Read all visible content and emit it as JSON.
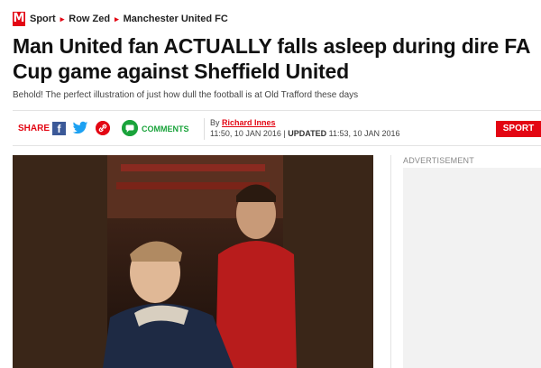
{
  "breadcrumb": {
    "logo": "M",
    "items": [
      "Sport",
      "Row Zed",
      "Manchester United FC"
    ]
  },
  "article": {
    "headline": "Man United fan ACTUALLY falls asleep during dire FA Cup game against Sheffield United",
    "standfirst": "Behold! The perfect illustration of just how dull the football is at Old Trafford these days"
  },
  "share": {
    "label": "SHARE",
    "facebook": "f",
    "comments_label": "COMMENTS"
  },
  "byline": {
    "by": "By",
    "author": "Richard Innes",
    "published": "11:50, 10 JAN 2016",
    "separator": "|",
    "updated_label": "UPDATED",
    "updated": "11:53, 10 JAN 2016"
  },
  "section_button": "SPORT",
  "advert": {
    "label": "ADVERTISEMENT"
  },
  "colors": {
    "brand": "#e30613",
    "facebook": "#3b5998",
    "twitter": "#1da1f2",
    "comments": "#1aa33b"
  }
}
